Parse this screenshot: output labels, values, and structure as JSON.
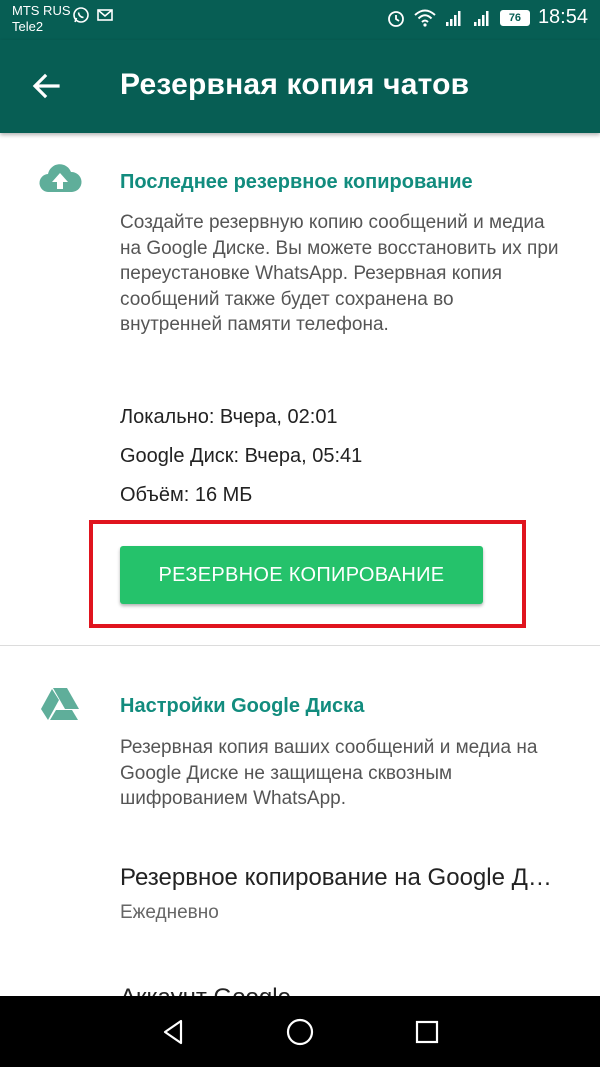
{
  "status_bar": {
    "carrier1": "MTS RUS",
    "carrier2": "Tele2",
    "battery": "76",
    "time": "18:54"
  },
  "app_bar": {
    "title": "Резервная копия чатов"
  },
  "last_backup": {
    "icon": "cloud-upload-icon",
    "title": "Последнее резервное копирование",
    "description": "Создайте резервную копию сообщений и медиа на Google Диске. Вы можете восстановить их при переустановке WhatsApp. Резервная копия сообщений также будет сохранена во внутренней памяти телефона.",
    "local": "Локально: Вчера, 02:01",
    "google_drive": "Google Диск: Вчера, 05:41",
    "size": "Объём: 16 МБ",
    "button_label": "РЕЗЕРВНОЕ КОПИРОВАНИЕ"
  },
  "google_drive_settings": {
    "icon": "google-drive-icon",
    "title": "Настройки Google Диска",
    "description": "Резервная копия ваших сообщений и медиа на Google Диске не защищена сквозным шифрованием WhatsApp.",
    "items": [
      {
        "title": "Резервное копирование на Google Диск",
        "subtitle": "Ежедневно"
      },
      {
        "title": "Аккаунт Google",
        "subtitle": ""
      }
    ]
  },
  "colors": {
    "primary_dark": "#075e54",
    "accent_text": "#128c7e",
    "button": "#25c26b",
    "highlight": "#e0141e",
    "icon": "#5fae9a"
  }
}
